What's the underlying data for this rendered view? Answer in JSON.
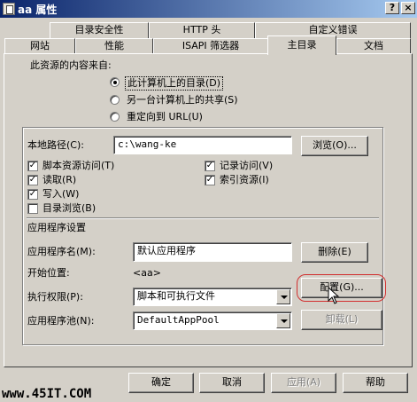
{
  "window": {
    "title": "aa 属性",
    "help_glyph": "?",
    "close_glyph": "×"
  },
  "tabs": {
    "row1": [
      "目录安全性",
      "HTTP 头",
      "自定义错误"
    ],
    "row2": [
      "网站",
      "性能",
      "ISAPI 筛选器",
      "主目录",
      "文档"
    ],
    "active": "主目录"
  },
  "content_source": {
    "heading": "此资源的内容来自:",
    "options": [
      {
        "label": "此计算机上的目录(D)",
        "selected": true
      },
      {
        "label": "另一台计算机上的共享(S)",
        "selected": false
      },
      {
        "label": "重定向到 URL(U)",
        "selected": false
      }
    ]
  },
  "local_path": {
    "label": "本地路径(C):",
    "value": "c:\\wang-ke",
    "browse_button": "浏览(O)..."
  },
  "checkboxes": {
    "left": [
      {
        "label": "脚本资源访问(T)",
        "checked": true
      },
      {
        "label": "读取(R)",
        "checked": true
      },
      {
        "label": "写入(W)",
        "checked": true
      },
      {
        "label": "目录浏览(B)",
        "checked": false
      }
    ],
    "right": [
      {
        "label": "记录访问(V)",
        "checked": true
      },
      {
        "label": "索引资源(I)",
        "checked": true
      }
    ]
  },
  "app_settings": {
    "heading": "应用程序设置",
    "app_name_label": "应用程序名(M):",
    "app_name_value": "默认应用程序",
    "remove_button": "删除(E)",
    "start_point_label": "开始位置:",
    "start_point_value": "<aa>",
    "config_button": "配置(G)...",
    "exec_perm_label": "执行权限(P):",
    "exec_perm_value": "脚本和可执行文件",
    "app_pool_label": "应用程序池(N):",
    "app_pool_value": "DefaultAppPool",
    "unload_button": "卸载(L)"
  },
  "footer": {
    "watermark": "www.45IT.COM",
    "ok": "确定",
    "cancel": "取消",
    "apply": "应用(A)",
    "help": "帮助"
  },
  "colors": {
    "titlebar_start": "#0a246a",
    "titlebar_end": "#a6caf0",
    "face": "#d4d0c8",
    "highlight_ring": "#d23030"
  }
}
